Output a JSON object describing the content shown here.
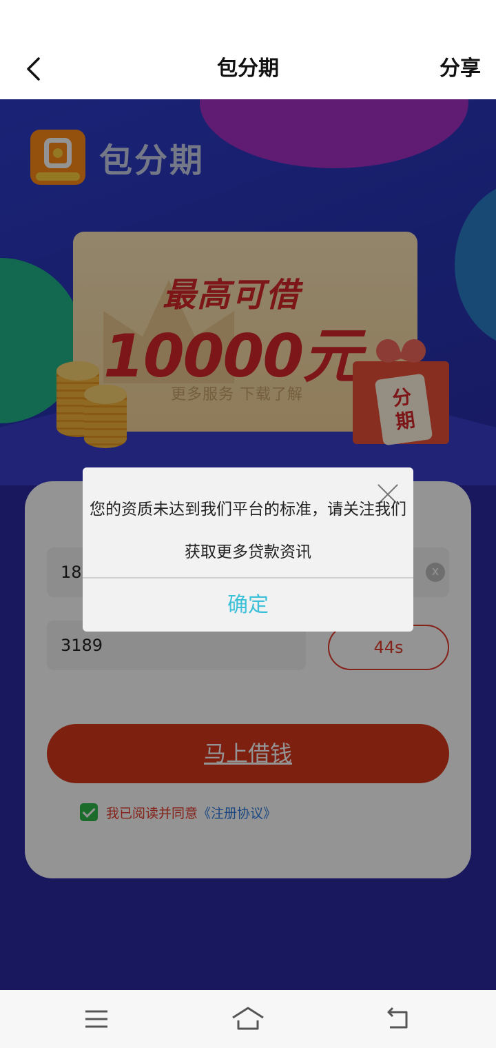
{
  "header": {
    "title": "包分期",
    "share_label": "分享"
  },
  "hero": {
    "logo_text": "包分期",
    "promo_headline": "最高可借",
    "promo_amount": "10000元",
    "promo_sub": "更多服务   下载了解",
    "gift_tag": "分期"
  },
  "form": {
    "phone_value": "183",
    "clear_label": "x",
    "code_value": "3189",
    "countdown": "44s",
    "borrow_label": "马上借钱",
    "agree_text": "我已阅读并同意",
    "agree_link": "《注册协议》"
  },
  "dialog": {
    "message": "您的资质未达到我们平台的标准，请关注我们获取更多贷款资讯",
    "confirm_label": "确定"
  },
  "colors": {
    "accent_red": "#e33a2a",
    "confirm_blue": "#3cc1d8",
    "link_blue": "#2f7be0",
    "check_green": "#2fb94a"
  },
  "icons": {
    "back": "chevron-left-icon",
    "close": "close-icon",
    "nav_menu": "menu-icon",
    "nav_home": "home-icon",
    "nav_back": "back-icon"
  }
}
